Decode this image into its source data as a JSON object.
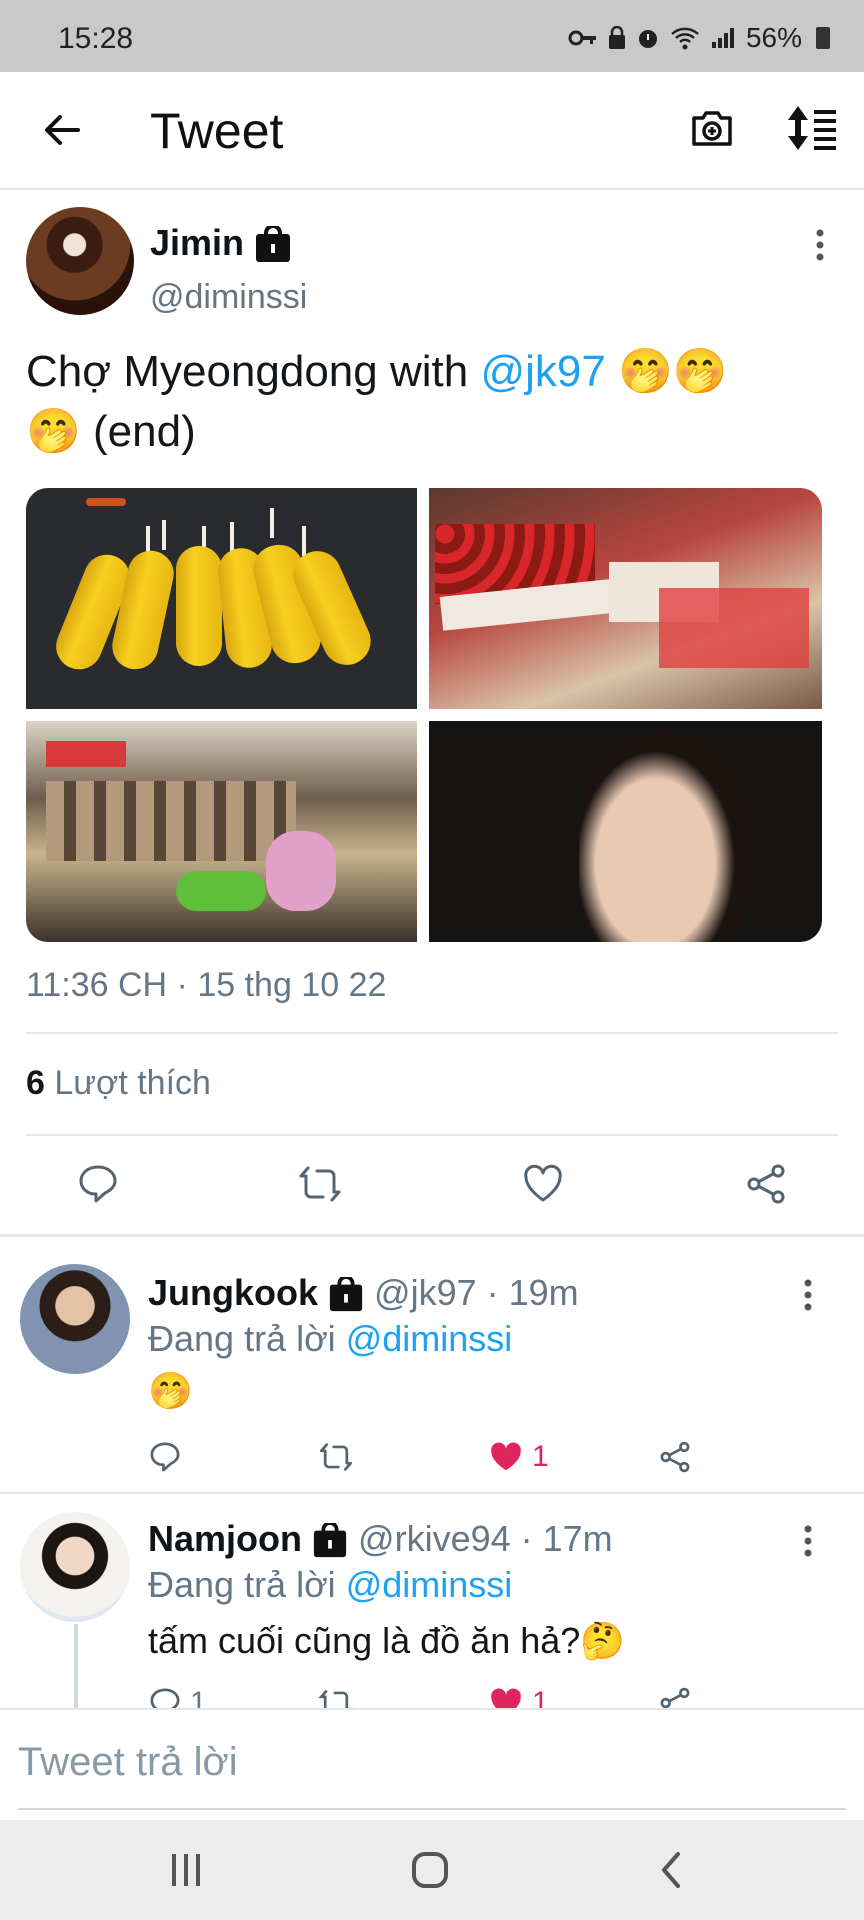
{
  "status_bar": {
    "time": "15:28",
    "battery": "56%"
  },
  "header": {
    "title": "Tweet"
  },
  "tweet": {
    "author": {
      "name": "Jimin",
      "handle": "@diminssi"
    },
    "text_before": "Chợ Myeongdong with ",
    "mention": "@jk97",
    "emoji_1": "🤭🤭",
    "emoji_2": "🤭",
    "text_after": " (end)",
    "photos": [
      "corn-photo",
      "strawberry-stall-photo",
      "market-stall-photo",
      "portrait-photo"
    ],
    "timestamp": "11:36 CH · 15 thg 10 22",
    "likes_count": "6",
    "likes_label": " Lượt thích"
  },
  "replies": [
    {
      "name": "Jungkook",
      "meta": " @jk97 · 19m",
      "replying_prefix": "Đang trả lời ",
      "replying_to": "@diminssi",
      "text": "🤭",
      "like_count": "1",
      "reply_count": "",
      "liked": true
    },
    {
      "name": "Namjoon",
      "meta": " @rkive94 · 17m",
      "replying_prefix": "Đang trả lời ",
      "replying_to": "@diminssi",
      "text": "tấm cuối cũng là đồ ăn hả?🤔",
      "like_count": "1",
      "reply_count": "1",
      "liked": true
    }
  ],
  "composer": {
    "placeholder": "Tweet trả lời"
  },
  "colors": {
    "accent": "#1da1f2",
    "like": "#e0245e",
    "secondary_text": "#657786"
  },
  "icons": [
    "back-arrow-icon",
    "camera-add-icon",
    "sort-icon",
    "lock-icon",
    "more-vertical-icon",
    "reply-icon",
    "retweet-icon",
    "heart-icon",
    "share-icon"
  ]
}
